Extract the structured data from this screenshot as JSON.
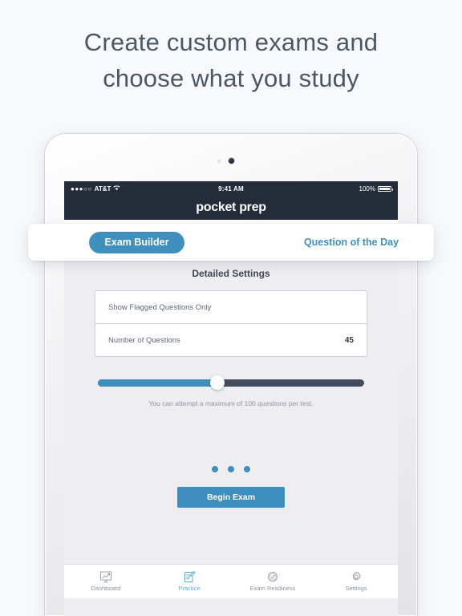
{
  "headline": {
    "line1": "Create custom exams and",
    "line2": "choose what you study"
  },
  "device": {
    "status_bar": {
      "signal_dots": "●●●○○",
      "carrier": "AT&T",
      "wifi_icon": "wifi-icon",
      "time": "9:41 AM",
      "battery_percent": "100%",
      "battery_icon": "battery-full-icon"
    },
    "nav": {
      "title": "pocket prep"
    }
  },
  "segmented_control": {
    "active_tab": "Exam Builder",
    "inactive_tab": "Question of the Day",
    "accent_color": "#3f8fbf"
  },
  "main": {
    "section_title": "Detailed Settings",
    "settings": [
      {
        "label": "Show Flagged Questions Only",
        "value": ""
      },
      {
        "label": "Number of Questions",
        "value": "45"
      }
    ],
    "slider": {
      "value": 45,
      "min": 0,
      "max": 100,
      "fill_color": "#3e8fbe",
      "track_color": "#414c5c"
    },
    "slider_help_line1": "You can attempt a maximum of 100",
    "slider_help_line2": "questions per test.",
    "page_dots": 3,
    "begin_button": "Begin Exam"
  },
  "tabbar": {
    "items": [
      {
        "label": "Dashboard",
        "icon": "dashboard-chart-icon",
        "active": false
      },
      {
        "label": "Practice",
        "icon": "document-pencil-icon",
        "active": true
      },
      {
        "label": "Exam Readiness",
        "icon": "check-circle-icon",
        "active": false
      },
      {
        "label": "Settings",
        "icon": "gear-icon",
        "active": false
      }
    ]
  }
}
